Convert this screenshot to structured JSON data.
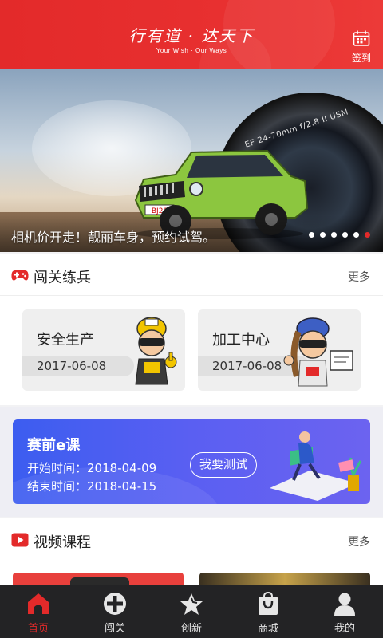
{
  "header": {
    "brand_title": "行有道 · 达天下",
    "brand_subtitle": "Your Wish · Our Ways",
    "signin_label": "签到",
    "signin_icon": "calendar-icon",
    "color": "#e32a2a"
  },
  "banner": {
    "caption": "相机价开走！靓丽车身，预约试驾。",
    "lens_text": "EF 24-70mm f/2.8 II USM",
    "plate_text": "BJ20",
    "slide_count": 6,
    "active_slide": 6
  },
  "challenge": {
    "title": "闯关练兵",
    "icon": "gamepad-icon",
    "more": "更多",
    "cards": [
      {
        "title": "安全生产",
        "date": "2017-06-08",
        "figure": "miner-mascot-icon"
      },
      {
        "title": "加工中心",
        "date": "2017-06-08",
        "figure": "worker-mascot-icon"
      }
    ]
  },
  "exam": {
    "title": "赛前e课",
    "start_label": "开始时间：",
    "start_date": "2018-04-09",
    "end_label": "结束时间：",
    "end_date": "2018-04-15",
    "button": "我要测试",
    "illustration": "person-laptop-icon"
  },
  "video": {
    "title": "视频课程",
    "icon": "play-icon",
    "more": "更多"
  },
  "tabbar": {
    "tabs": [
      {
        "label": "首页",
        "icon": "home-icon",
        "active": true
      },
      {
        "label": "闯关",
        "icon": "gamepad-icon",
        "active": false
      },
      {
        "label": "创新",
        "icon": "star-icon",
        "active": false
      },
      {
        "label": "商城",
        "icon": "shopping-bag-icon",
        "active": false
      },
      {
        "label": "我的",
        "icon": "user-icon",
        "active": false
      }
    ],
    "active_color": "#e32a2a"
  }
}
